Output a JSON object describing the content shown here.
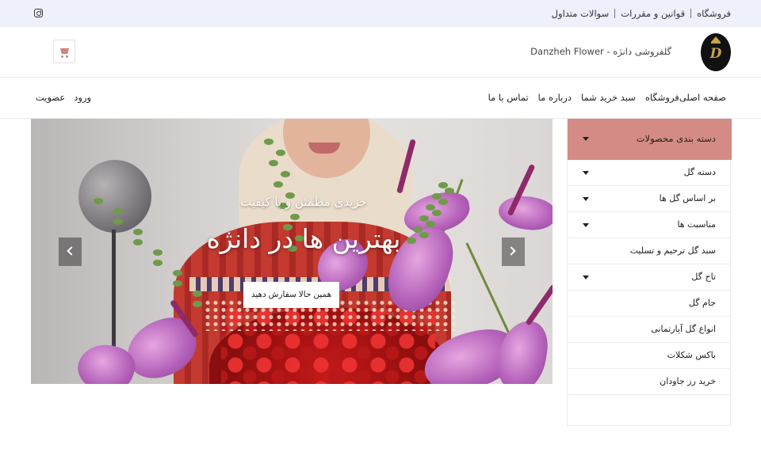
{
  "topbar": {
    "links": [
      "فروشگاه",
      "قوانین و مقررات",
      "سوالات متداول"
    ],
    "social_icon": "instagram-icon"
  },
  "header": {
    "logo_monogram": "D",
    "site_name": "گلفروشی دانژه - Danzheh Flower",
    "cart_icon": "cart-icon"
  },
  "nav": {
    "menu": [
      "صفحه اصلی",
      "فروشگاه",
      "سبد خرید شما",
      "درباره ما",
      "تماس با ما"
    ],
    "auth": [
      "عضویت",
      "ورود"
    ]
  },
  "slider": {
    "subtitle": "خریدی مطمئن و با کیفیت",
    "title": "بهترین ها در دانژه",
    "cta": "همین حالا سفارش دهید"
  },
  "sidebar": {
    "header": "دسته بندی محصولات",
    "items": [
      {
        "label": "دسته گل",
        "has_submenu": true
      },
      {
        "label": "بر اساس گل ها",
        "has_submenu": true
      },
      {
        "label": "مناسبت ها",
        "has_submenu": true
      },
      {
        "label": "سبد گل ترحیم و تسلیت",
        "has_submenu": false
      },
      {
        "label": "تاج گل",
        "has_submenu": true
      },
      {
        "label": "جام گل",
        "has_submenu": false
      },
      {
        "label": "انواع گل آپارتمانی",
        "has_submenu": false
      },
      {
        "label": "باکس شکلات",
        "has_submenu": false
      },
      {
        "label": "خرید رز جاودان",
        "has_submenu": false
      }
    ]
  },
  "colors": {
    "topbar_bg": "#eef0fb",
    "accent": "#d48b86"
  }
}
